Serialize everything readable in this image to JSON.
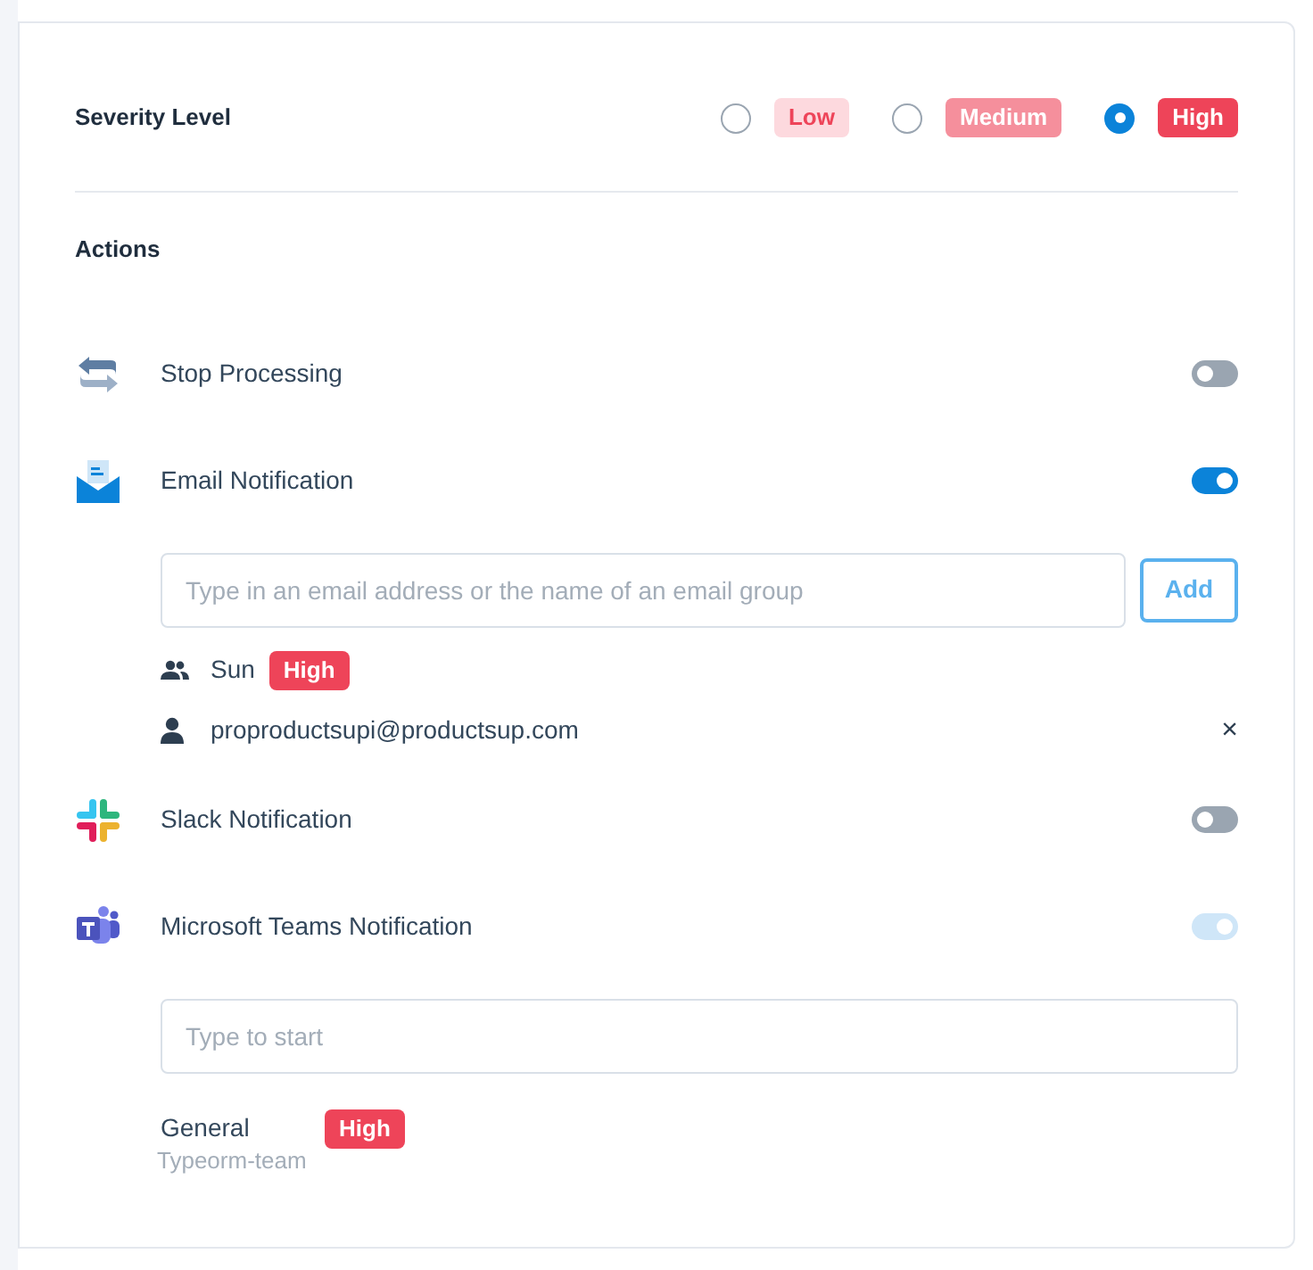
{
  "severity": {
    "label": "Severity Level",
    "options": [
      {
        "label": "Low",
        "kind": "low",
        "selected": false
      },
      {
        "label": "Medium",
        "kind": "medium",
        "selected": false
      },
      {
        "label": "High",
        "kind": "high",
        "selected": true
      }
    ]
  },
  "actions": {
    "title": "Actions",
    "items": [
      {
        "kind": "stop",
        "label": "Stop Processing",
        "on": false,
        "disabled": false
      },
      {
        "kind": "email",
        "label": "Email Notification",
        "on": true,
        "disabled": false,
        "input": {
          "placeholder": "Type in an email address or the name of an email group"
        },
        "button": "Add",
        "recipients": [
          {
            "kind": "group",
            "name": "Sun",
            "badge": {
              "label": "High",
              "kind": "high"
            }
          },
          {
            "kind": "person",
            "name": "proproductsupi@productsup.com",
            "remove": "×"
          }
        ]
      },
      {
        "kind": "slack",
        "label": "Slack Notification",
        "on": false,
        "disabled": false
      },
      {
        "kind": "teams",
        "label": "Microsoft Teams Notification",
        "on": true,
        "disabled": true,
        "input": {
          "placeholder": "Type to start"
        },
        "channels": [
          {
            "name": "General",
            "team": "Typeorm-team",
            "badge": {
              "label": "High",
              "kind": "high"
            }
          }
        ]
      }
    ]
  }
}
